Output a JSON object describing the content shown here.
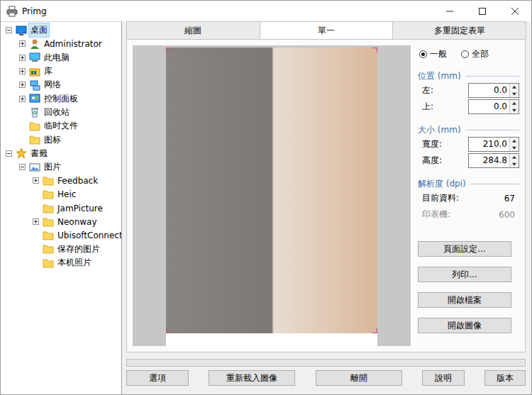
{
  "window": {
    "title": "Primg"
  },
  "tree": [
    {
      "label": "桌面",
      "depth": 0,
      "kind": "desktop",
      "has_children": true,
      "expanded": true,
      "selected": true
    },
    {
      "label": "Administrator",
      "depth": 1,
      "kind": "user",
      "has_children": true,
      "expanded": false,
      "selected": false
    },
    {
      "label": "此电脑",
      "depth": 1,
      "kind": "computer",
      "has_children": true,
      "expanded": false,
      "selected": false
    },
    {
      "label": "库",
      "depth": 1,
      "kind": "library",
      "has_children": true,
      "expanded": false,
      "selected": false
    },
    {
      "label": "网络",
      "depth": 1,
      "kind": "network",
      "has_children": true,
      "expanded": false,
      "selected": false
    },
    {
      "label": "控制面板",
      "depth": 1,
      "kind": "control",
      "has_children": true,
      "expanded": false,
      "selected": false
    },
    {
      "label": "回收站",
      "depth": 1,
      "kind": "recycle",
      "has_children": false,
      "expanded": false,
      "selected": false
    },
    {
      "label": "临时文件",
      "depth": 1,
      "kind": "folder",
      "has_children": false,
      "expanded": false,
      "selected": false
    },
    {
      "label": "图标",
      "depth": 1,
      "kind": "folder",
      "has_children": false,
      "expanded": false,
      "selected": false
    },
    {
      "label": "書籤",
      "depth": 0,
      "kind": "star",
      "has_children": true,
      "expanded": true,
      "selected": false
    },
    {
      "label": "图片",
      "depth": 1,
      "kind": "pictures",
      "has_children": true,
      "expanded": true,
      "selected": false
    },
    {
      "label": "Feedback",
      "depth": 2,
      "kind": "folder",
      "has_children": true,
      "expanded": false,
      "selected": false
    },
    {
      "label": "Heic",
      "depth": 2,
      "kind": "folder",
      "has_children": false,
      "expanded": false,
      "selected": false
    },
    {
      "label": "JamPicture",
      "depth": 2,
      "kind": "folder",
      "has_children": false,
      "expanded": false,
      "selected": false
    },
    {
      "label": "Neonway",
      "depth": 2,
      "kind": "folder",
      "has_children": true,
      "expanded": false,
      "selected": false
    },
    {
      "label": "UbisoftConnect",
      "depth": 2,
      "kind": "folder",
      "has_children": false,
      "expanded": false,
      "selected": false
    },
    {
      "label": "保存的图片",
      "depth": 2,
      "kind": "folder",
      "has_children": false,
      "expanded": false,
      "selected": false
    },
    {
      "label": "本机照片",
      "depth": 2,
      "kind": "folder",
      "has_children": false,
      "expanded": false,
      "selected": false
    }
  ],
  "tabs": [
    {
      "label": "縮圖",
      "selected": false
    },
    {
      "label": "單一",
      "selected": true
    },
    {
      "label": "多重固定表單",
      "selected": false
    }
  ],
  "view_mode": [
    {
      "label": "一般",
      "selected": true
    },
    {
      "label": "全部",
      "selected": false
    }
  ],
  "sections": [
    {
      "title": "位置 (mm)",
      "fields": [
        {
          "label": "左:",
          "value": "0.0"
        },
        {
          "label": "上:",
          "value": "0.0"
        }
      ]
    },
    {
      "title": "大小 (mm)",
      "fields": [
        {
          "label": "寬度:",
          "value": "210.0"
        },
        {
          "label": "高度:",
          "value": "284.8"
        }
      ]
    }
  ],
  "resolution": {
    "title": "解析度 (dpi)",
    "rows": [
      {
        "label": "目前資料:",
        "value": "67",
        "disabled": false
      },
      {
        "label": "印表機:",
        "value": "600",
        "disabled": true
      }
    ]
  },
  "side_buttons": [
    "頁面設定...",
    "列印...",
    "開啟檔案",
    "開啟圖像"
  ],
  "progress": {
    "level": 0
  },
  "bottom_buttons": [
    "選項",
    "重新載入圖像",
    "離開",
    "說明",
    "版本"
  ]
}
